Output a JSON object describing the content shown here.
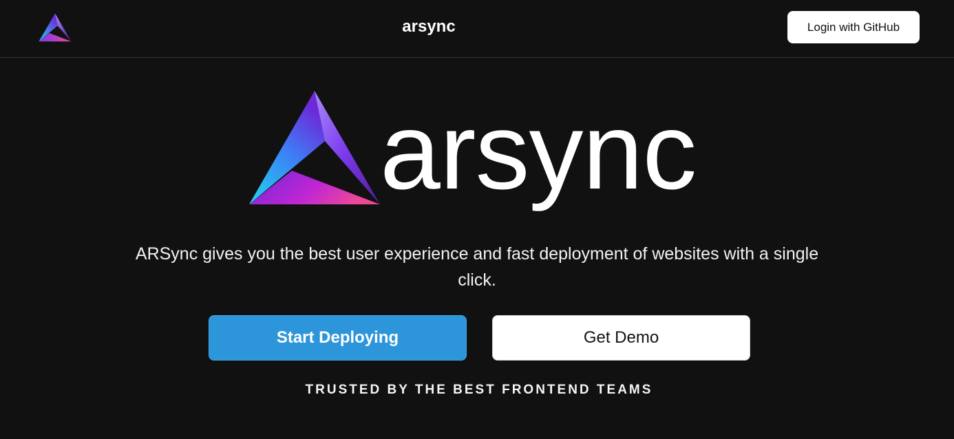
{
  "header": {
    "brand": "arsync",
    "login_label": "Login with GitHub"
  },
  "hero": {
    "wordmark": "arsync",
    "tagline": "ARSync gives you the best user experience and fast deployment of websites with a single click.",
    "primary_cta": "Start Deploying",
    "secondary_cta": "Get Demo",
    "trusted_text": "TRUSTED BY THE BEST FRONTEND TEAMS"
  },
  "colors": {
    "background": "#111111",
    "primary_button": "#2d96db",
    "logo_gradient": [
      "#22d3ee",
      "#7c3aed",
      "#ec4899"
    ]
  },
  "icons": {
    "nav_logo": "arsync-triangle-logo-icon",
    "hero_logo": "arsync-triangle-logo-icon"
  }
}
